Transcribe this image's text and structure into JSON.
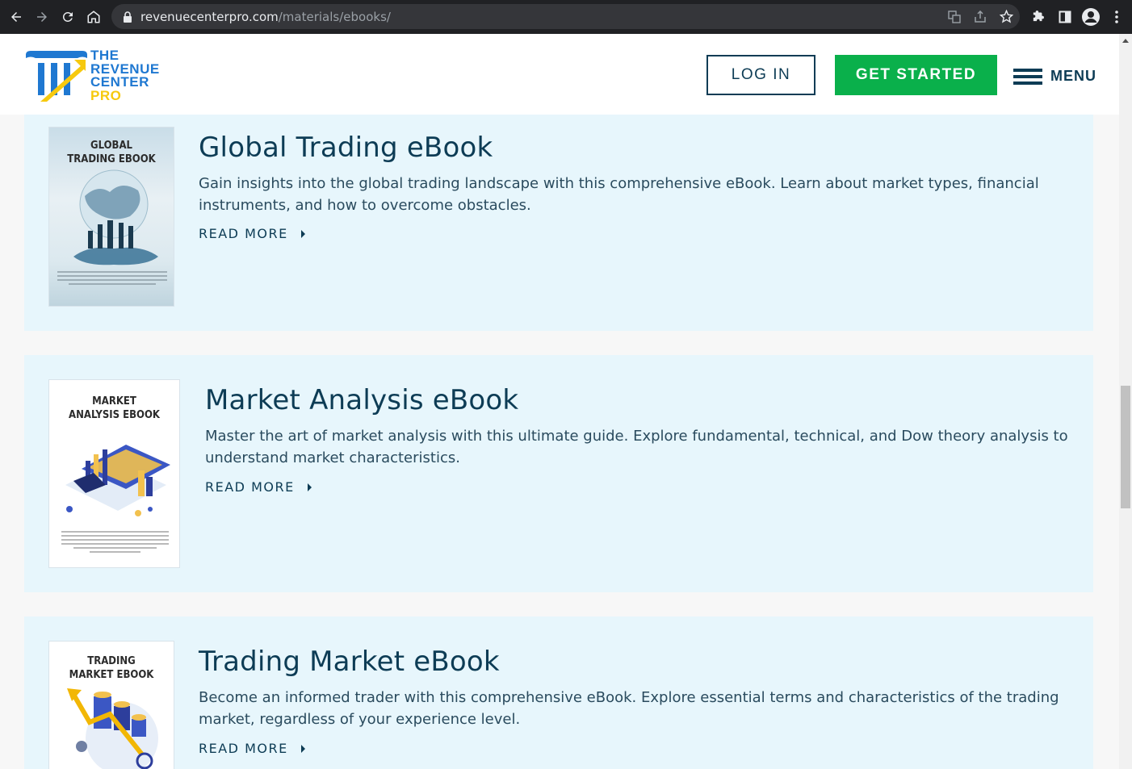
{
  "browser": {
    "url_host": "revenuecenterpro.com",
    "url_path": "/materials/ebooks/"
  },
  "header": {
    "logo_lines": [
      "THE",
      "REVENUE",
      "CENTER",
      "PRO"
    ],
    "login_label": "LOG IN",
    "get_started_label": "GET STARTED",
    "menu_label": "MENU"
  },
  "colors": {
    "brand_blue": "#1f78d1",
    "brand_yellow": "#f6c90e",
    "navy": "#0d3c55",
    "cta_green": "#0ab04b",
    "card_bg": "#e7f6fc"
  },
  "ebooks": [
    {
      "cover_title_1": "GLOBAL",
      "cover_title_2": "TRADING EBOOK",
      "title": "Global Trading eBook",
      "description": "Gain insights into the global trading landscape with this comprehensive eBook. Learn about market types, financial instruments, and how to overcome obstacles.",
      "read_more": "READ MORE"
    },
    {
      "cover_title_1": "MARKET",
      "cover_title_2": "ANALYSIS EBOOK",
      "title": "Market Analysis eBook",
      "description": "Master the art of market analysis with this ultimate guide. Explore fundamental, technical, and Dow theory analysis to understand market characteristics.",
      "read_more": "READ MORE"
    },
    {
      "cover_title_1": "TRADING",
      "cover_title_2": "MARKET EBOOK",
      "title": "Trading Market eBook",
      "description": "Become an informed trader with this comprehensive eBook. Explore essential terms and characteristics of the trading market, regardless of your experience level.",
      "read_more": "READ MORE"
    }
  ]
}
